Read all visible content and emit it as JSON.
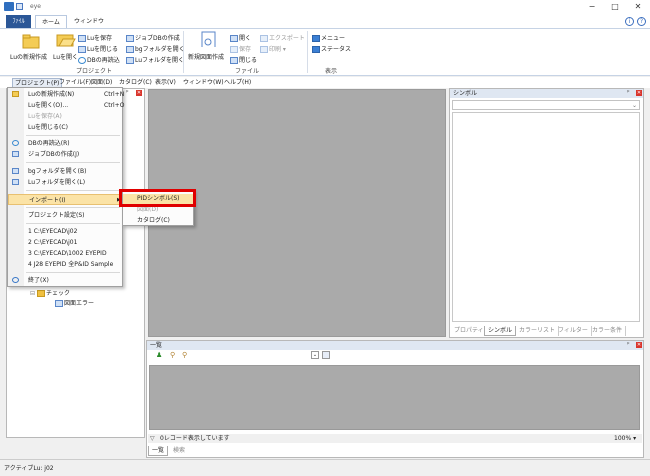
{
  "window": {
    "title": "eye",
    "controls": {
      "minimize": "−",
      "maximize": "□",
      "close": "✕"
    }
  },
  "ribbon_tabs": {
    "file": "ﾌｧｲﾙ",
    "home": "ホーム",
    "window": "ウィンドウ"
  },
  "ribbon": {
    "project_group": {
      "label": "プロジェクト",
      "new_lu": "Luの新規作成",
      "open_lu": "Luを開く",
      "save_lu": "Luを保存",
      "close_lu": "Luを閉じる",
      "reload_db": "DBの再読込",
      "create_symbol_db": "ジョブDBの作成",
      "open_bg_folder": "bgフォルダを開く",
      "open_lu_folder": "Luフォルダを開く"
    },
    "file_group": {
      "label": "ファイル",
      "new_drawing": "新規図面作成",
      "open": "開く",
      "save": "保存",
      "close": "閉じる",
      "export": "エクスポート",
      "print": "印刷"
    },
    "view_group": {
      "label": "表示",
      "menu": "メニュー",
      "status": "ステータス"
    }
  },
  "menubar": {
    "project": "プロジェクト(P)",
    "file": "ファイル(F)",
    "drawing": "図面(D)",
    "catalog": "カタログ(C)",
    "view": "表示(V)",
    "window": "ウィンドウ(W)",
    "help": "ヘルプ(H)"
  },
  "dropdown": {
    "items": [
      {
        "label": "Luの新規作成(N)",
        "shortcut": "Ctrl+N"
      },
      {
        "label": "Luを開く(O)...",
        "shortcut": "Ctrl+O"
      },
      {
        "label": "Luを保存(A)",
        "shortcut": ""
      },
      {
        "label": "Luを閉じる(C)",
        "shortcut": ""
      },
      {
        "label": "DBの再読込(R)",
        "shortcut": ""
      },
      {
        "label": "ジョブDBの作成(J)",
        "shortcut": ""
      },
      {
        "label": "bgフォルダを開く(B)",
        "shortcut": ""
      },
      {
        "label": "Luフォルダを開く(L)",
        "shortcut": ""
      },
      {
        "label": "インポート(I)",
        "shortcut": ""
      },
      {
        "label": "プロジェクト設定(S)",
        "shortcut": ""
      },
      {
        "label": "1 C:\\EYECAD\\j02",
        "shortcut": ""
      },
      {
        "label": "2 C:\\EYECAD\\j01",
        "shortcut": ""
      },
      {
        "label": "3 C:\\EYECAD\\1002 EYEPID",
        "shortcut": ""
      },
      {
        "label": "4 J28 EYEPID 全P&ID Sample",
        "shortcut": ""
      },
      {
        "label": "終了(X)",
        "shortcut": ""
      }
    ]
  },
  "submenu": {
    "items": [
      "PIDシンボル(S)",
      "図面(D)",
      "カタログ(C)"
    ]
  },
  "left_panel": {
    "tree": {
      "check": "チェック",
      "drawing_error": "図面エラー"
    }
  },
  "right_panel": {
    "title": "シンボル",
    "tabs": [
      "プロパティ",
      "シンボル",
      "カラーリスト",
      "フィルター",
      "カラー条件"
    ]
  },
  "bottom_panel": {
    "title": "一覧",
    "status": "0レコード表示しています",
    "zoom": "100%",
    "tabs": [
      "一覧",
      "検索"
    ]
  },
  "statusbar": {
    "text": "アクティブLu: j02"
  },
  "colors": {
    "accent": "#2b5797",
    "highlight": "#fbe3a6",
    "annotation_red": "#e00000",
    "workspace_gray": "#aaaaaa"
  }
}
